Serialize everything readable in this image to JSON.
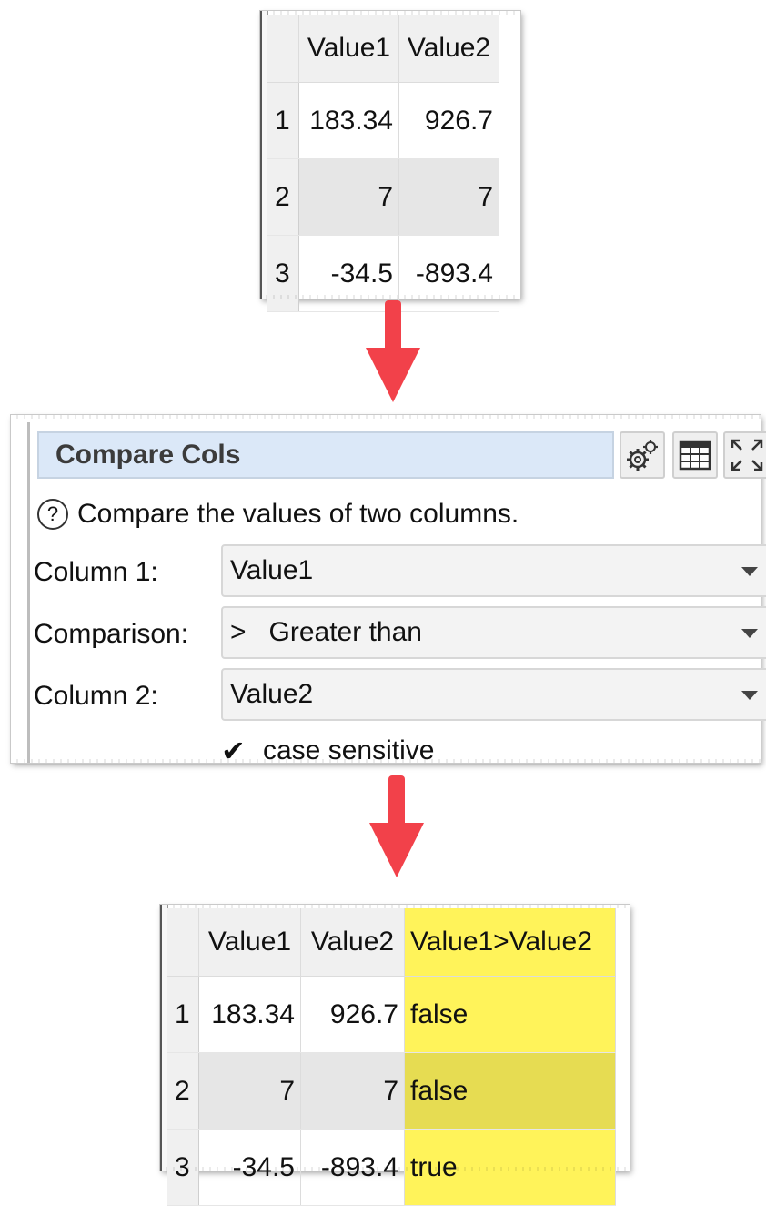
{
  "input_table": {
    "columns": [
      "Value1",
      "Value2"
    ],
    "rows": [
      {
        "num": "1",
        "cells": [
          "183.34",
          "926.7"
        ]
      },
      {
        "num": "2",
        "cells": [
          "7",
          "7"
        ]
      },
      {
        "num": "3",
        "cells": [
          "-34.5",
          "-893.4"
        ]
      }
    ]
  },
  "dialog": {
    "title": "Compare Cols",
    "description": "Compare the values of two columns.",
    "help_glyph": "?",
    "column1_label": "Column 1:",
    "column1_value": "Value1",
    "comparison_label": "Comparison:",
    "comparison_value": ">   Greater than",
    "column2_label": "Column 2:",
    "column2_value": "Value2",
    "case_sensitive_label": "case sensitive",
    "case_sensitive_checked": true,
    "icons": [
      "settings-gears-icon",
      "table-icon",
      "expand-icon"
    ]
  },
  "output_table": {
    "columns": [
      "Value1",
      "Value2",
      "Value1>Value2"
    ],
    "rows": [
      {
        "num": "1",
        "cells": [
          "183.34",
          "926.7",
          "false"
        ]
      },
      {
        "num": "2",
        "cells": [
          "7",
          "7",
          "false"
        ]
      },
      {
        "num": "3",
        "cells": [
          "-34.5",
          "-893.4",
          "true"
        ]
      }
    ]
  },
  "colors": {
    "arrow": "#f2414a",
    "highlight": "#fff35a",
    "title_bar": "#dbe8f8"
  }
}
